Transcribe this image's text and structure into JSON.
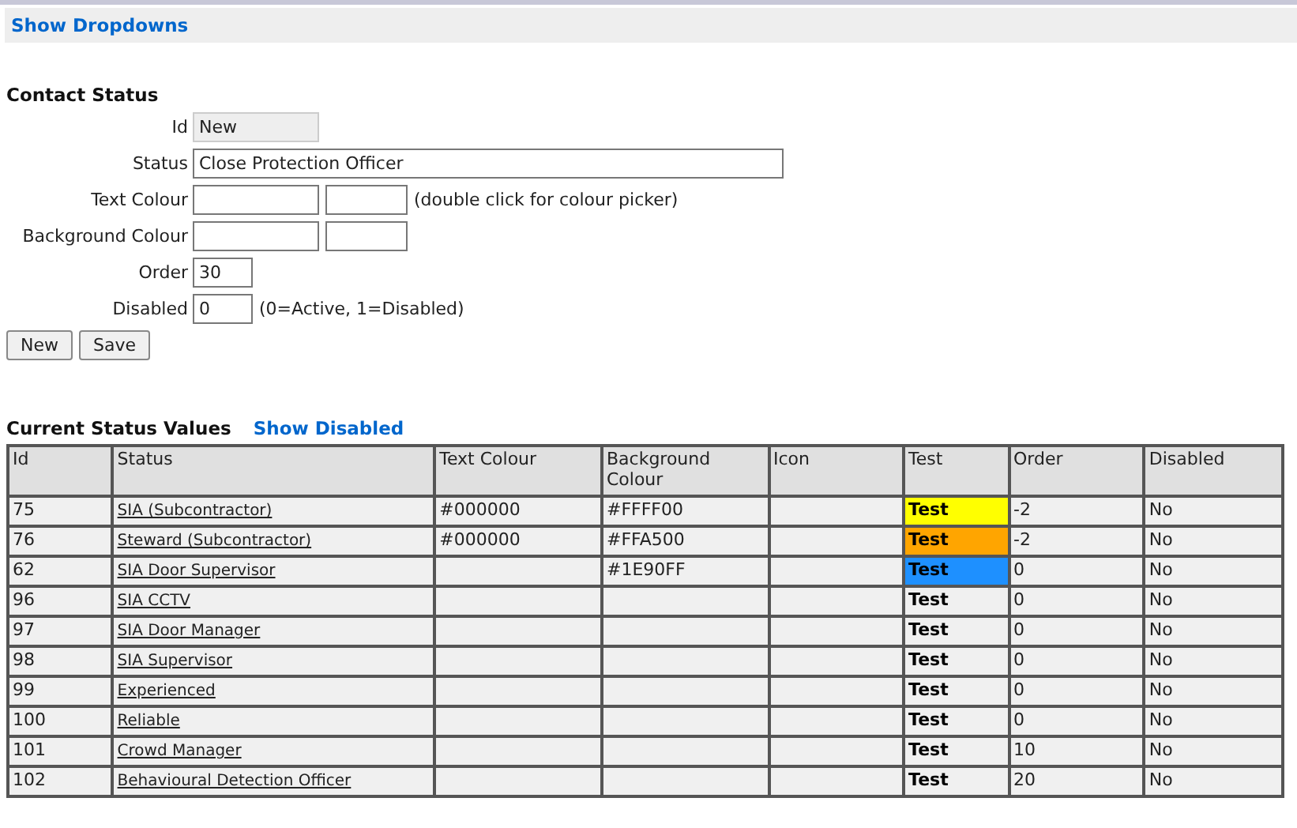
{
  "header": {
    "link": "Show Dropdowns"
  },
  "form": {
    "title": "Contact Status",
    "fields": [
      {
        "label": "Id",
        "inputs": [
          {
            "kind": "medium",
            "value": "New",
            "readonly": true
          }
        ]
      },
      {
        "label": "Status",
        "inputs": [
          {
            "kind": "long",
            "value": "Close Protection Officer",
            "readonly": false
          }
        ]
      },
      {
        "label": "Text Colour",
        "inputs": [
          {
            "kind": "medium",
            "readonly": false
          },
          {
            "kind": "small",
            "readonly": false
          }
        ],
        "note": "(double click for colour picker)"
      },
      {
        "label": "Background Colour",
        "inputs": [
          {
            "kind": "medium",
            "readonly": false
          },
          {
            "kind": "small",
            "readonly": false
          }
        ]
      },
      {
        "label": "Order",
        "inputs": [
          {
            "kind": "short",
            "value": "30",
            "readonly": false
          }
        ]
      },
      {
        "label": "Disabled",
        "inputs": [
          {
            "kind": "short",
            "value": "0",
            "readonly": false
          }
        ],
        "note": "(0=Active, 1=Disabled)"
      }
    ],
    "buttons": [
      "New",
      "Save"
    ]
  },
  "table": {
    "title": "Current Status Values",
    "link": "Show Disabled",
    "columns": [
      "Id",
      "Status",
      "Text Colour",
      "Background Colour",
      "Icon",
      "Test",
      "Order",
      "Disabled"
    ],
    "rows": [
      {
        "id": "75",
        "status": "SIA (Subcontractor)",
        "text_colour": "#000000",
        "background_colour": "#FFFF00",
        "test": "Test",
        "color": "#ffff00",
        "order": "-2",
        "disabled": "No"
      },
      {
        "id": "76",
        "status": "Steward (Subcontractor)",
        "text_colour": "#000000",
        "background_colour": "#FFA500",
        "test": "Test",
        "color": "#ffa500",
        "order": "-2",
        "disabled": "No"
      },
      {
        "id": "62",
        "status": "SIA Door Supervisor",
        "background_colour": "#1E90FF",
        "test": "Test",
        "color": "#1e90ff",
        "order": "0",
        "disabled": "No"
      },
      {
        "id": "96",
        "status": "SIA CCTV",
        "test": "Test",
        "order": "0",
        "disabled": "No"
      },
      {
        "id": "97",
        "status": "SIA Door Manager",
        "test": "Test",
        "order": "0",
        "disabled": "No"
      },
      {
        "id": "98",
        "status": "SIA Supervisor",
        "test": "Test",
        "order": "0",
        "disabled": "No"
      },
      {
        "id": "99",
        "status": "Experienced",
        "test": "Test",
        "order": "0",
        "disabled": "No"
      },
      {
        "id": "100",
        "status": "Reliable",
        "test": "Test",
        "order": "0",
        "disabled": "No"
      },
      {
        "id": "101",
        "status": "Crowd Manager",
        "test": "Test",
        "order": "10",
        "disabled": "No"
      },
      {
        "id": "102",
        "status": "Behavioural Detection Officer",
        "test": "Test",
        "order": "20",
        "disabled": "No"
      }
    ]
  }
}
